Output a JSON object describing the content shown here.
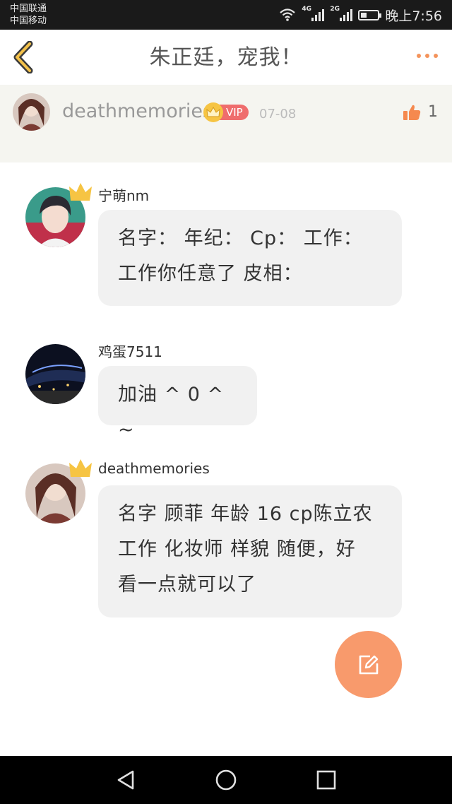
{
  "status_bar": {
    "carrier_1": "中国联通",
    "carrier_2": "中国移动",
    "network_1": "4G",
    "network_2": "2G",
    "time": "晚上7:56",
    "battery_level": 0.35
  },
  "nav": {
    "title": "朱正廷，宠我！",
    "back_icon": "chevron-left-icon",
    "more_icon": "more-dots-icon",
    "accent": "#f4945c"
  },
  "author": {
    "name": "deathmemories",
    "vip_label": "VIP",
    "date": "07-08",
    "like_count": "1",
    "like_icon": "thumbs-up-icon"
  },
  "comments": [
    {
      "name": "宁萌nm",
      "crown": true,
      "lines": [
        "名字：  年纪：  Cp：  工作：",
        "工作你任意了 皮相："
      ]
    },
    {
      "name": "鸡蛋7511",
      "crown": false,
      "lines": [
        "加油 ^ 0 ^ ~"
      ]
    },
    {
      "name": "deathmemories",
      "crown": true,
      "lines": [
        "名字 顾菲 年龄 16  cp陈立农",
        "工作 化妆师 样貌 随便，好",
        "看一点就可以了"
      ]
    }
  ],
  "fab": {
    "icon": "edit-icon",
    "color": "#f89a6c"
  },
  "system_nav": {
    "back_icon": "triangle-back-icon",
    "home_icon": "circle-home-icon",
    "recents_icon": "square-recents-icon"
  }
}
